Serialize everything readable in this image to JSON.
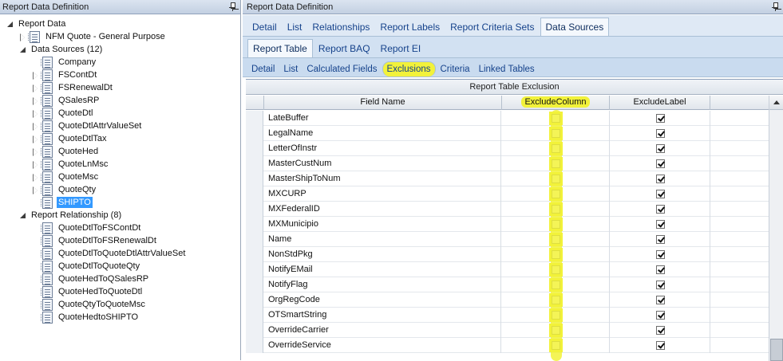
{
  "left_panel": {
    "title": "Report Data Definition",
    "tree": {
      "root": "Report Data",
      "nfm_quote": "NFM Quote - General Purpose",
      "data_sources_header": "Data Sources (12)",
      "data_sources": [
        "Company",
        "FSContDt",
        "FSRenewalDt",
        "QSalesRP",
        "QuoteDtl",
        "QuoteDtlAttrValueSet",
        "QuoteDtlTax",
        "QuoteHed",
        "QuoteLnMsc",
        "QuoteMsc",
        "QuoteQty",
        "SHIPTO"
      ],
      "relationship_header": "Report Relationship (8)",
      "relationships": [
        "QuoteDtlToFSContDt",
        "QuoteDtlToFSRenewalDt",
        "QuoteDtlToQuoteDtlAttrValueSet",
        "QuoteDtlToQuoteQty",
        "QuoteHedToQSalesRP",
        "QuoteHedToQuoteDtl",
        "QuoteQtyToQuoteMsc",
        "QuoteHedtoSHIPTO"
      ]
    }
  },
  "right_panel": {
    "title": "Report Data Definition",
    "tabs_row1": [
      "Detail",
      "List",
      "Relationships",
      "Report Labels",
      "Report Criteria Sets",
      "Data Sources"
    ],
    "tabs_row2": [
      "Report Table",
      "Report BAQ",
      "Report EI"
    ],
    "tabs_row3": [
      "Detail",
      "List",
      "Calculated Fields",
      "Exclusions",
      "Criteria",
      "Linked Tables"
    ],
    "grid": {
      "caption": "Report Table Exclusion",
      "columns": [
        "Field Name",
        "ExcludeColumn",
        "ExcludeLabel"
      ],
      "rows": [
        "LateBuffer",
        "LegalName",
        "LetterOfInstr",
        "MasterCustNum",
        "MasterShipToNum",
        "MXCURP",
        "MXFederalID",
        "MXMunicipio",
        "Name",
        "NonStdPkg",
        "NotifyEMail",
        "NotifyFlag",
        "OrgRegCode",
        "OTSmartString",
        "OverrideCarrier",
        "OverrideService"
      ],
      "exclude_column_checked": false,
      "exclude_label_checked": true
    }
  },
  "colors": {
    "highlight": "#f2f23a",
    "selection": "#3399ff",
    "tab_text": "#15428b"
  }
}
